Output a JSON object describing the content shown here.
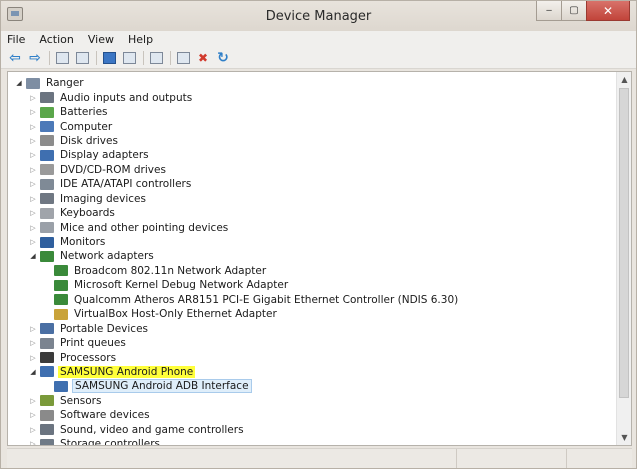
{
  "window": {
    "title": "Device Manager",
    "min": "‒",
    "max": "▢",
    "close": "✕"
  },
  "menu": [
    "File",
    "Action",
    "View",
    "Help"
  ],
  "toolbar": [
    {
      "name": "back-icon",
      "glyph": "⇦",
      "cls": "tb-arrow"
    },
    {
      "name": "forward-icon",
      "glyph": "⇨",
      "cls": "tb-arrow"
    },
    {
      "name": "sep"
    },
    {
      "name": "properties-icon",
      "glyph": "",
      "cls": "tb-box"
    },
    {
      "name": "show-hide-icon",
      "glyph": "",
      "cls": "tb-box"
    },
    {
      "name": "sep"
    },
    {
      "name": "help-icon",
      "glyph": "",
      "cls": "tb-box blue"
    },
    {
      "name": "details-icon",
      "glyph": "",
      "cls": "tb-box"
    },
    {
      "name": "sep"
    },
    {
      "name": "scan-hardware-icon",
      "glyph": "",
      "cls": "tb-box"
    },
    {
      "name": "sep"
    },
    {
      "name": "update-driver-icon",
      "glyph": "",
      "cls": "tb-box"
    },
    {
      "name": "uninstall-icon",
      "glyph": "✖",
      "cls": "tb-x"
    },
    {
      "name": "enable-device-icon",
      "glyph": "↻",
      "cls": "tb-arrow"
    }
  ],
  "tree": [
    {
      "label": "Ranger",
      "level": 0,
      "exp": "open",
      "icon": "computer-icon",
      "color": "#7e8ea3"
    },
    {
      "label": "Audio inputs and outputs",
      "level": 1,
      "exp": "closed",
      "icon": "speaker-icon",
      "color": "#6b7480"
    },
    {
      "label": "Batteries",
      "level": 1,
      "exp": "closed",
      "icon": "battery-icon",
      "color": "#5aa64a"
    },
    {
      "label": "Computer",
      "level": 1,
      "exp": "closed",
      "icon": "computer-icon",
      "color": "#4c79b8"
    },
    {
      "label": "Disk drives",
      "level": 1,
      "exp": "closed",
      "icon": "disk-drive-icon",
      "color": "#8c8c8c"
    },
    {
      "label": "Display adapters",
      "level": 1,
      "exp": "closed",
      "icon": "display-adapter-icon",
      "color": "#3f6fb0"
    },
    {
      "label": "DVD/CD-ROM drives",
      "level": 1,
      "exp": "closed",
      "icon": "dvd-drive-icon",
      "color": "#9a9a9a"
    },
    {
      "label": "IDE ATA/ATAPI controllers",
      "level": 1,
      "exp": "closed",
      "icon": "ide-controller-icon",
      "color": "#7f8a96"
    },
    {
      "label": "Imaging devices",
      "level": 1,
      "exp": "closed",
      "icon": "camera-icon",
      "color": "#6f7782"
    },
    {
      "label": "Keyboards",
      "level": 1,
      "exp": "closed",
      "icon": "keyboard-icon",
      "color": "#a0a4aa"
    },
    {
      "label": "Mice and other pointing devices",
      "level": 1,
      "exp": "closed",
      "icon": "mouse-icon",
      "color": "#9aa0a8"
    },
    {
      "label": "Monitors",
      "level": 1,
      "exp": "closed",
      "icon": "monitor-icon",
      "color": "#2f5f9e"
    },
    {
      "label": "Network adapters",
      "level": 1,
      "exp": "open",
      "icon": "network-adapter-icon",
      "color": "#3a8a3a"
    },
    {
      "label": "Broadcom 802.11n Network Adapter",
      "level": 2,
      "exp": "none",
      "icon": "network-adapter-icon",
      "color": "#3a8a3a"
    },
    {
      "label": "Microsoft Kernel Debug Network Adapter",
      "level": 2,
      "exp": "none",
      "icon": "network-adapter-icon",
      "color": "#3a8a3a"
    },
    {
      "label": "Qualcomm Atheros AR8151 PCI-E Gigabit Ethernet Controller (NDIS 6.30)",
      "level": 2,
      "exp": "none",
      "icon": "network-adapter-icon",
      "color": "#3a8a3a"
    },
    {
      "label": "VirtualBox Host-Only Ethernet Adapter",
      "level": 2,
      "exp": "none",
      "icon": "network-adapter-icon",
      "color": "#c9a33a"
    },
    {
      "label": "Portable Devices",
      "level": 1,
      "exp": "closed",
      "icon": "portable-device-icon",
      "color": "#4a6fa3"
    },
    {
      "label": "Print queues",
      "level": 1,
      "exp": "closed",
      "icon": "printer-icon",
      "color": "#7b8490"
    },
    {
      "label": "Processors",
      "level": 1,
      "exp": "closed",
      "icon": "processor-icon",
      "color": "#3b3b3b"
    },
    {
      "label": "SAMSUNG Android Phone",
      "level": 1,
      "exp": "open",
      "icon": "phone-icon",
      "color": "#3f6fb0",
      "style": "highlight"
    },
    {
      "label": "SAMSUNG Android ADB Interface",
      "level": 2,
      "exp": "none",
      "icon": "phone-icon",
      "color": "#3f6fb0",
      "style": "selected"
    },
    {
      "label": "Sensors",
      "level": 1,
      "exp": "closed",
      "icon": "sensor-icon",
      "color": "#7a9a3a"
    },
    {
      "label": "Software devices",
      "level": 1,
      "exp": "closed",
      "icon": "software-device-icon",
      "color": "#8a8a8a"
    },
    {
      "label": "Sound, video and game controllers",
      "level": 1,
      "exp": "closed",
      "icon": "speaker-icon",
      "color": "#6b7480"
    },
    {
      "label": "Storage controllers",
      "level": 1,
      "exp": "closed",
      "icon": "storage-controller-icon",
      "color": "#6f7a86"
    }
  ]
}
